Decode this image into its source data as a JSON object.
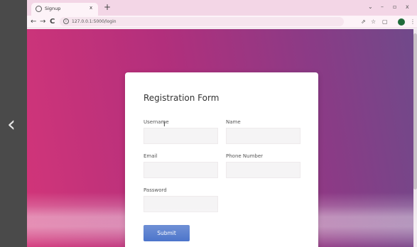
{
  "browser": {
    "tab_title": "Signup",
    "tab_close": "x",
    "new_tab": "+",
    "url": "127.0.0.1:5000/login",
    "window_controls": [
      "⌄",
      "–",
      "▫",
      "x"
    ]
  },
  "nav": {
    "back": "←",
    "forward": "→",
    "reload": "C"
  },
  "form": {
    "title": "Registration Form",
    "fields": [
      {
        "label": "Username",
        "value": ""
      },
      {
        "label": "Name",
        "value": ""
      },
      {
        "label": "Email",
        "value": ""
      },
      {
        "label": "Phone Number",
        "value": ""
      },
      {
        "label": "Password",
        "value": ""
      }
    ],
    "submit_label": "Submit"
  },
  "icons": {
    "left_arrow": "‹",
    "share": "⇗",
    "star": "☆",
    "sidebar": "▢",
    "menu": "⋮",
    "cursor": "I"
  },
  "colors": {
    "gradient_start": "#d23579",
    "gradient_end": "#6f4a8a",
    "submit_button": "#3563c4",
    "tab_strip": "#f3d6e6"
  }
}
